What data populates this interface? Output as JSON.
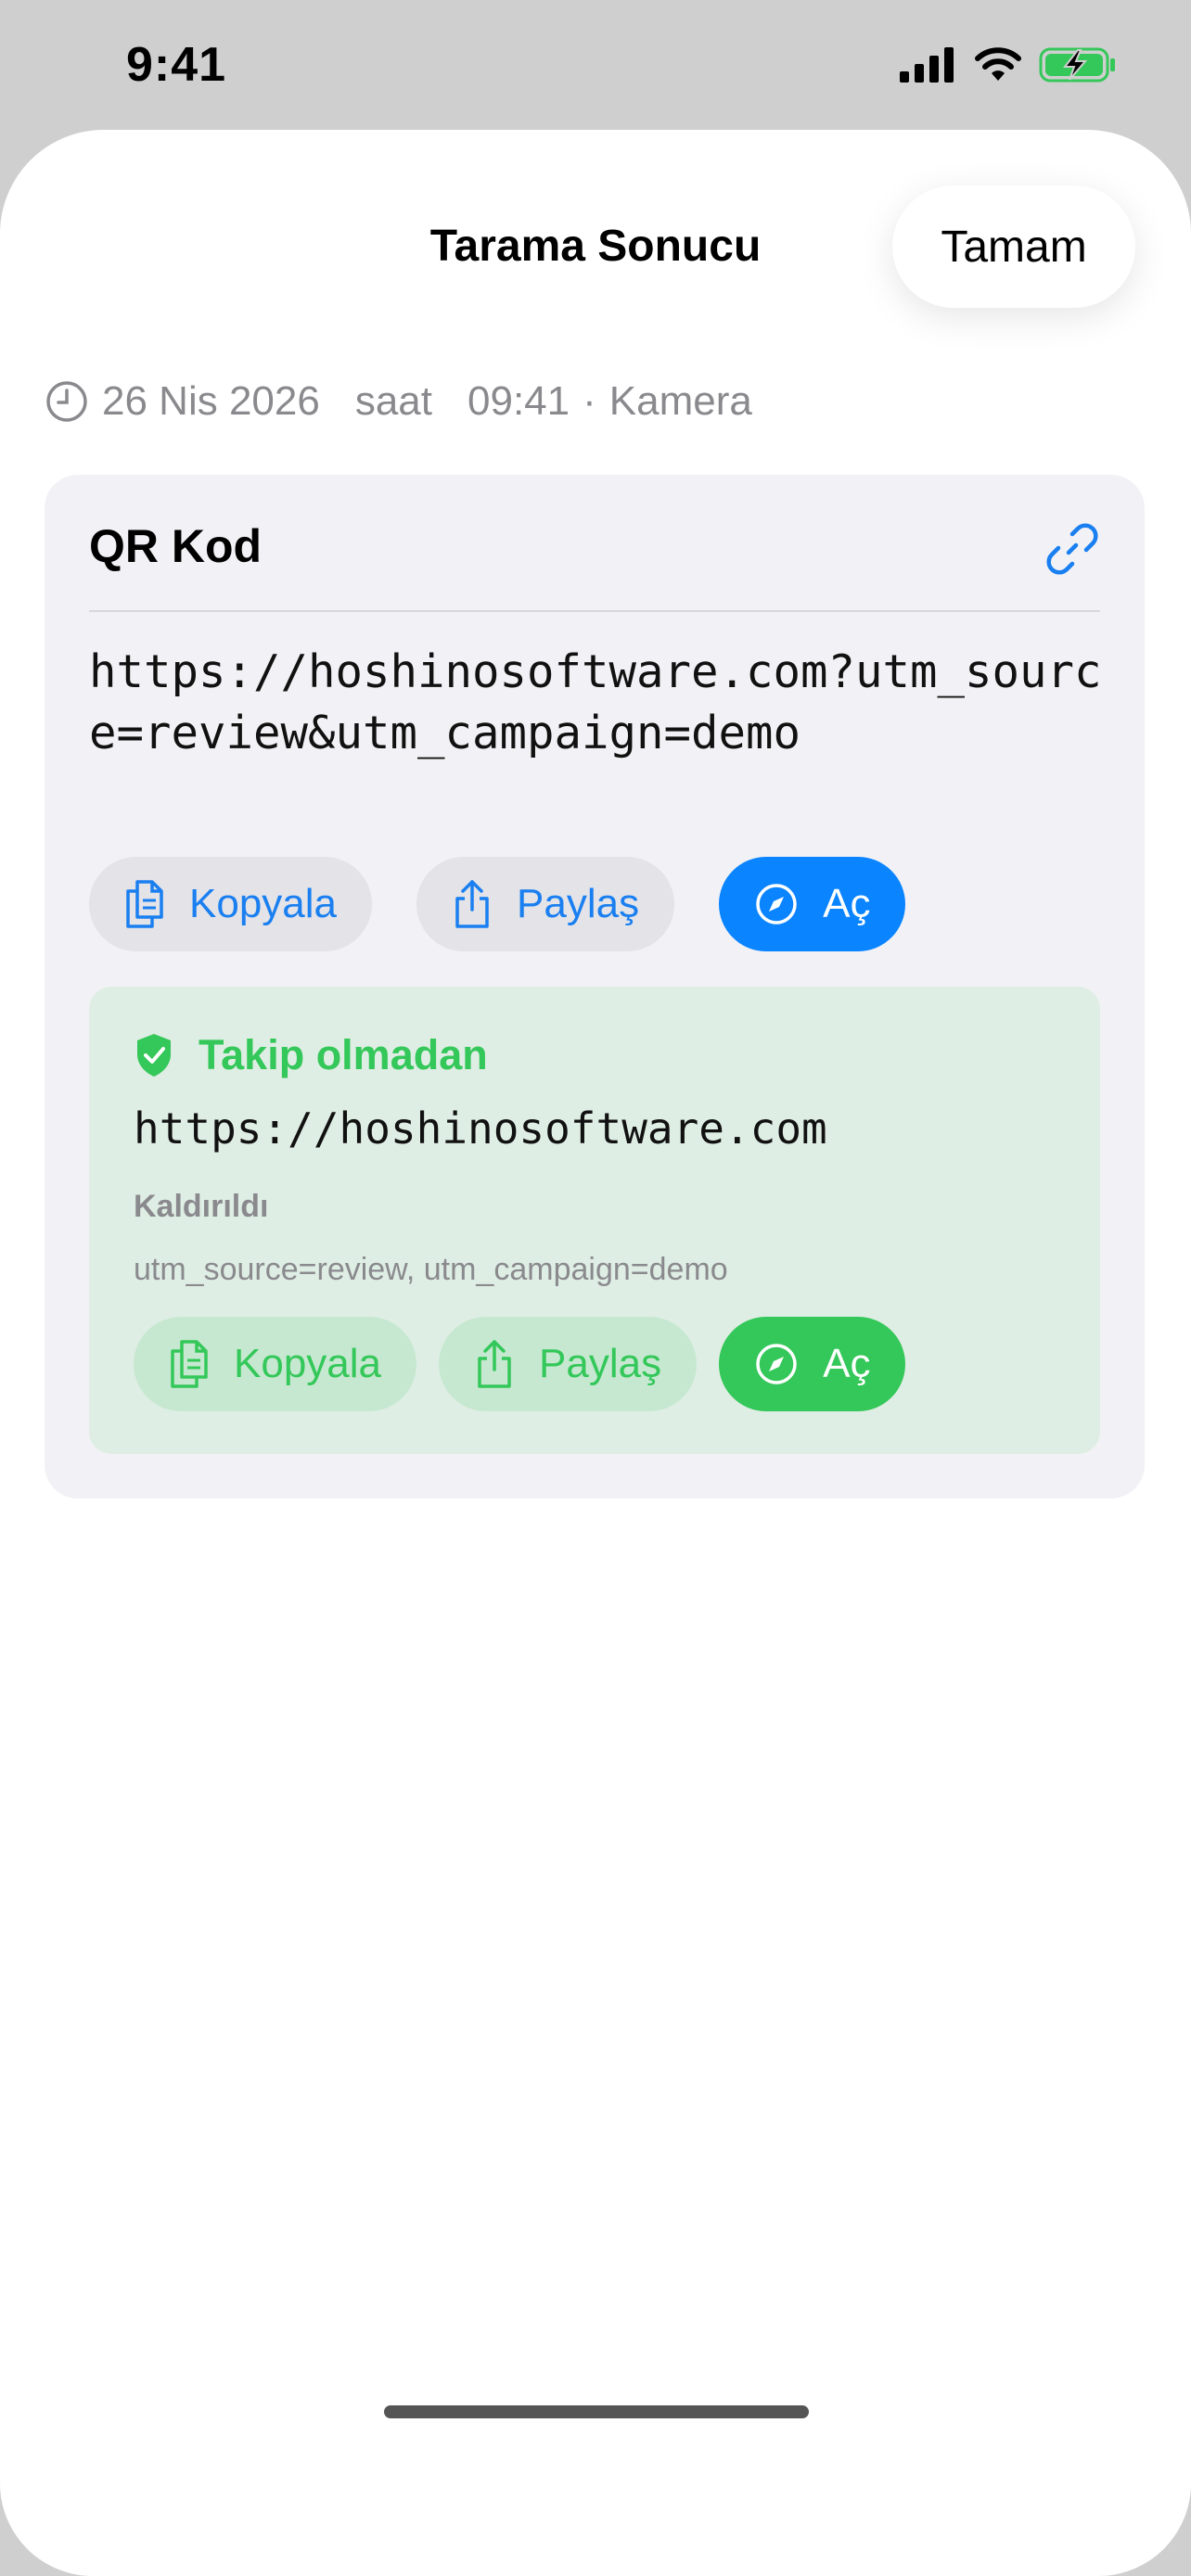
{
  "status_bar": {
    "time": "9:41"
  },
  "header": {
    "title": "Tarama Sonucu",
    "done_label": "Tamam"
  },
  "meta": {
    "date": "26 Nis 2026",
    "at": "saat",
    "time": "09:41",
    "separator": "·",
    "source": "Kamera"
  },
  "card": {
    "title": "QR Kod",
    "raw_url": "https://hoshinosoftware.com?utm_source=review&utm_campaign=demo",
    "actions": {
      "copy": "Kopyala",
      "share": "Paylaş",
      "open": "Aç"
    }
  },
  "clean": {
    "heading": "Takip olmadan",
    "url": "https://hoshinosoftware.com",
    "removed_label": "Kaldırıldı",
    "removed_params": "utm_source=review, utm_campaign=demo",
    "actions": {
      "copy": "Kopyala",
      "share": "Paylaş",
      "open": "Aç"
    }
  },
  "colors": {
    "accent": "#0a84ff",
    "success": "#34c759",
    "card_bg": "#f2f2f6",
    "clean_bg": "#dfeee4"
  },
  "icons": [
    "clock-icon",
    "link-icon",
    "copy-icon",
    "share-icon",
    "compass-icon",
    "shield-check-icon",
    "signal-icon",
    "wifi-icon",
    "battery-charging-icon"
  ]
}
